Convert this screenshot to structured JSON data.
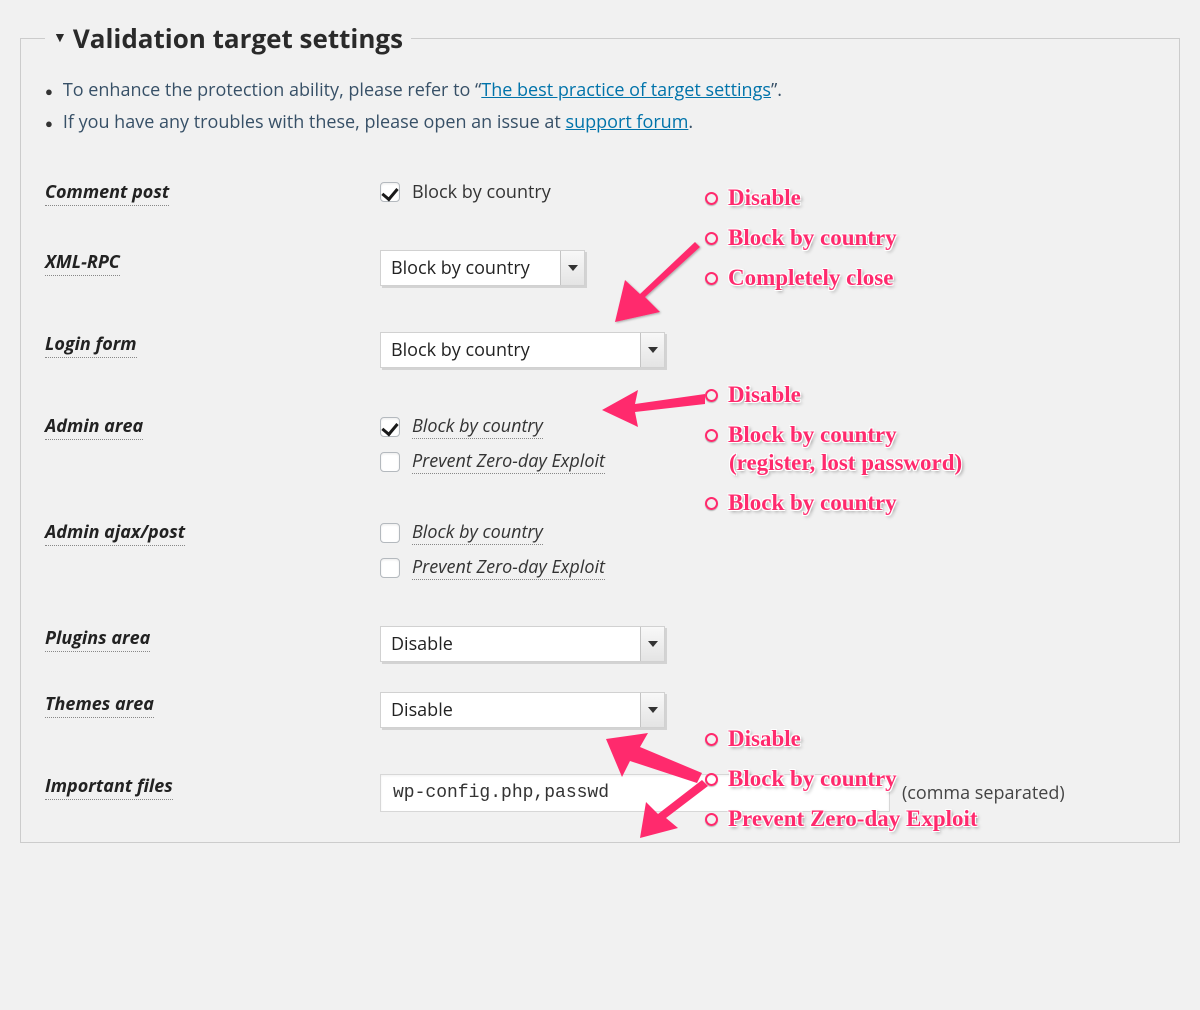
{
  "legend": "Validation target settings",
  "intro": {
    "line1_prefix": "To enhance the protection ability, please refer to “",
    "line1_link": "The best practice of target settings",
    "line1_suffix": "”.",
    "line2_prefix": "If you have any troubles with these, please open an issue at ",
    "line2_link": "support forum",
    "line2_suffix": "."
  },
  "rows": {
    "comment_post": {
      "label": "Comment post",
      "checkbox_label": "Block by country"
    },
    "xml_rpc": {
      "label": "XML-RPC",
      "select": "Block by country"
    },
    "login_form": {
      "label": "Login form",
      "select": "Block by country"
    },
    "admin_area": {
      "label": "Admin area",
      "cb1": "Block by country",
      "cb2": "Prevent Zero-day Exploit"
    },
    "admin_ajax": {
      "label": "Admin ajax/post",
      "cb1": "Block by country",
      "cb2": "Prevent Zero-day Exploit"
    },
    "plugins_area": {
      "label": "Plugins area",
      "select": "Disable"
    },
    "themes_area": {
      "label": "Themes area",
      "select": "Disable"
    },
    "important_files": {
      "label": "Important files",
      "value": "wp-config.php,passwd",
      "hint": "(comma separated)"
    }
  },
  "annotations": {
    "group1": [
      "Disable",
      "Block by country",
      "Completely close"
    ],
    "group2": [
      "Disable",
      "Block by country",
      "(register, lost password)",
      "Block by country"
    ],
    "group3": [
      "Disable",
      "Block by country",
      "Prevent Zero-day Exploit"
    ]
  }
}
